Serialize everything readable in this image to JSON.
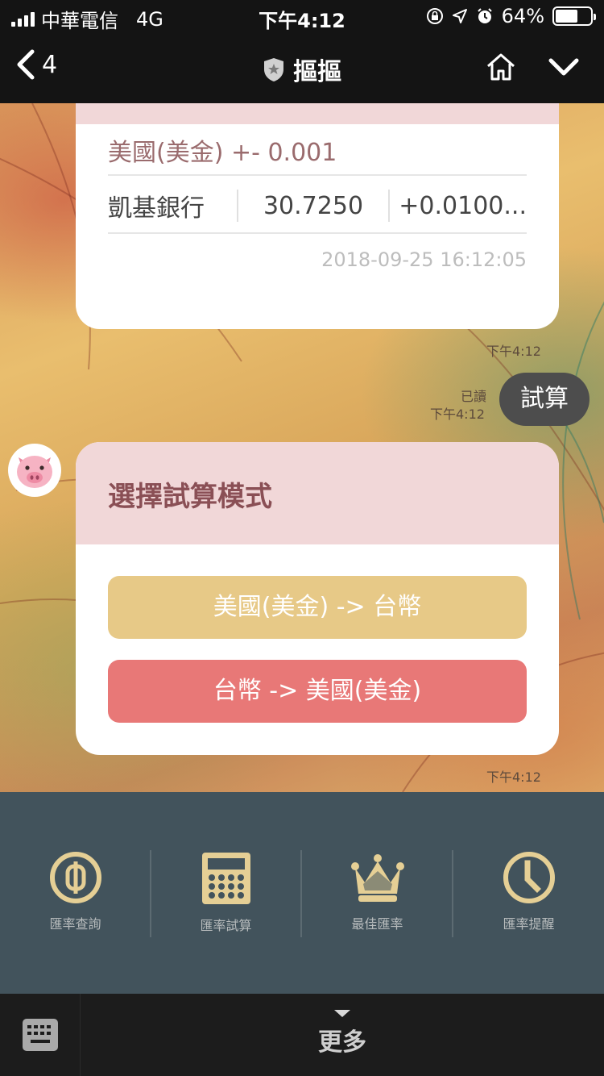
{
  "status_bar": {
    "carrier": "中華電信",
    "network": "4G",
    "time": "下午4:12",
    "battery_percent": "64%",
    "battery_level": 0.64
  },
  "nav": {
    "back_count": "4",
    "title": "摳摳",
    "icons": [
      "chevron-left-icon",
      "shield-star-icon",
      "home-icon",
      "chevron-down-icon"
    ]
  },
  "messages": {
    "rate_card": {
      "title": "美國(美金) +- 0.001",
      "bank": "凱基銀行",
      "rate": "30.7250",
      "change": "+0.0100...",
      "datetime": "2018-09-25 16:12:05",
      "timestamp": "下午4:12"
    },
    "user_message": {
      "text": "試算",
      "read_label": "已讀",
      "timestamp": "下午4:12"
    },
    "mode_card": {
      "title": "選擇試算模式",
      "option1": "美國(美金) -> 台幣",
      "option2": "台幣 -> 美國(美金)",
      "timestamp": "下午4:12"
    }
  },
  "rich_menu": {
    "items": [
      {
        "label": "匯率查詢",
        "icon": "dollar-coin-icon"
      },
      {
        "label": "匯率試算",
        "icon": "calculator-icon"
      },
      {
        "label": "最佳匯率",
        "icon": "crown-icon"
      },
      {
        "label": "匯率提醒",
        "icon": "clock-icon"
      }
    ]
  },
  "bottom_bar": {
    "more_label": "更多",
    "icons": [
      "keyboard-icon",
      "caret-down-icon"
    ]
  },
  "colors": {
    "menu_bg": "#42535c",
    "menu_icon": "#e5cf95",
    "card_header": "#f1d7d8",
    "option1": "#e7c987",
    "option2": "#e87877",
    "title_text": "#8a4f55"
  }
}
